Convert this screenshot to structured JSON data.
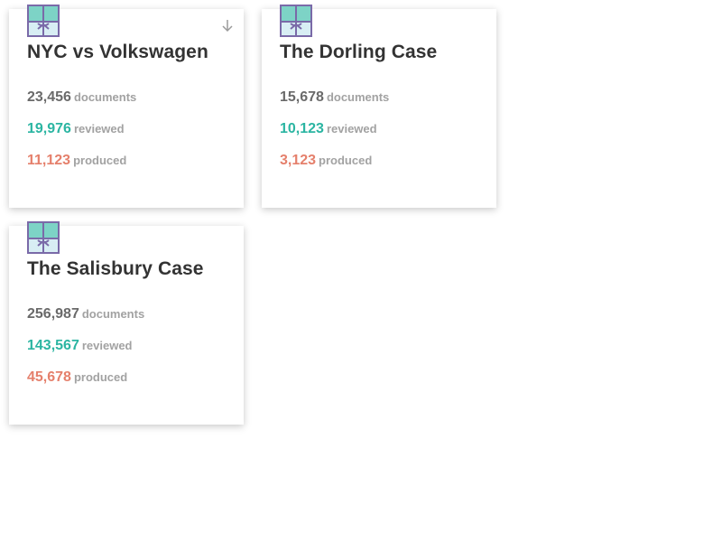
{
  "colors": {
    "documents": "#6a6a6a",
    "reviewed": "#2bb5a2",
    "produced": "#e5806c",
    "label": "#a2a2a2",
    "title": "#333333",
    "icon_fill": "#7dd3c6",
    "icon_border": "#7a6aa8"
  },
  "icons": {
    "case": "case-box-icon",
    "download": "download-arrow-icon"
  },
  "cases": [
    {
      "title": "NYC vs Volkswagen",
      "documents": "23,456",
      "documents_label": "documents",
      "reviewed": "19,976",
      "reviewed_label": "reviewed",
      "produced": "11,123",
      "produced_label": "produced"
    },
    {
      "title": "The Dorling Case",
      "documents": "15,678",
      "documents_label": "documents",
      "reviewed": "10,123",
      "reviewed_label": "reviewed",
      "produced": "3,123",
      "produced_label": "produced"
    },
    {
      "title": "The Salisbury Case",
      "documents": "256,987",
      "documents_label": "documents",
      "reviewed": "143,567",
      "reviewed_label": "reviewed",
      "produced": "45,678",
      "produced_label": "produced"
    }
  ]
}
